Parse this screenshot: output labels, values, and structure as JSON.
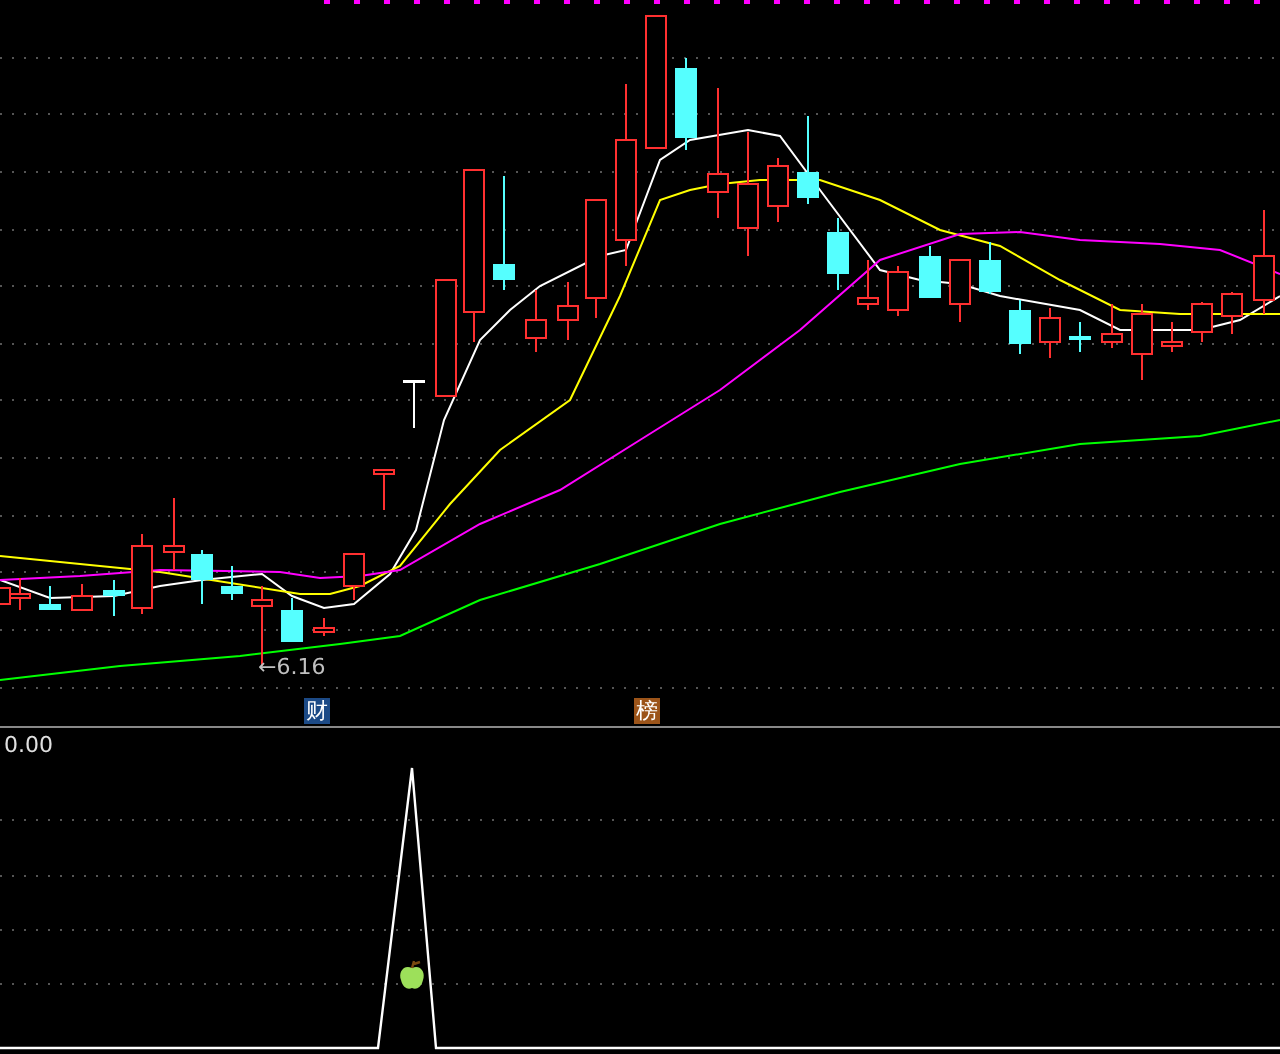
{
  "price_chart": {
    "low_marker": "←6.16",
    "event_badges": [
      {
        "label": "财",
        "color": "#1c4a86"
      },
      {
        "label": "榜",
        "color": "#9c5419"
      }
    ]
  },
  "indicator_panel": {
    "axis_label": "0.00"
  }
}
